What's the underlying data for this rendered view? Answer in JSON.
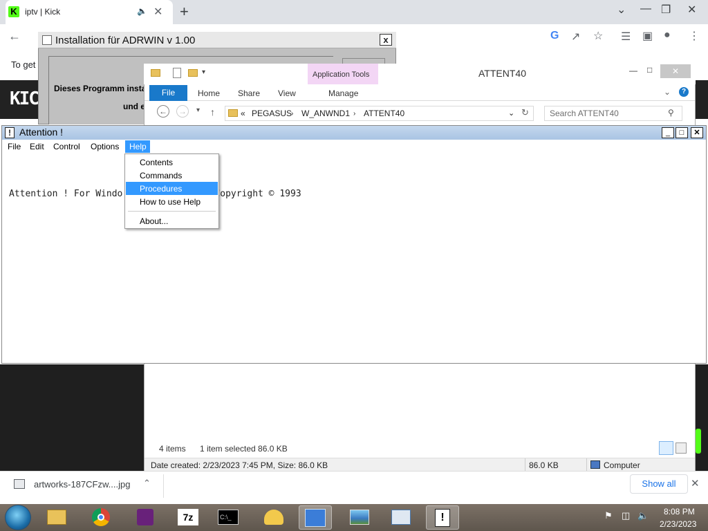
{
  "chrome": {
    "tab_title": "iptv | Kick",
    "tab_favicon": "K",
    "new_tab": "+",
    "webpage_text": "To get",
    "webpage_logo": "KIC"
  },
  "installer": {
    "title": "Installation für ADRWIN v 1.00",
    "close": "x",
    "line1": "Dieses Programm instal",
    "line2": "und e"
  },
  "explorer": {
    "app_tools": "Application Tools",
    "title": "ATTENT40",
    "ribbon_tabs": {
      "file": "File",
      "home": "Home",
      "share": "Share",
      "view": "View",
      "manage": "Manage"
    },
    "breadcrumb": {
      "sep": "«",
      "p1": "PEGASUS",
      "p2": "W_ANWND1",
      "p3": "ATTENT40"
    },
    "search_placeholder": "Search ATTENT40",
    "status_items": "4 items",
    "status_selected": "1 item selected  86.0 KB",
    "details_left": "Date created: 2/23/2023 7:45 PM, Size: 86.0 KB",
    "details_size": "86.0 KB",
    "details_location": "Computer"
  },
  "attention": {
    "title": "Attention !",
    "menubar": {
      "file": "File",
      "edit": "Edit",
      "control": "Control",
      "options": "Options",
      "help": "Help"
    },
    "body_text": "Attention ! For Windo              er Copyright © 1993",
    "help_menu": {
      "contents": "Contents",
      "commands": "Commands",
      "procedures": "Procedures",
      "how_to": "How to use Help",
      "about": "About..."
    }
  },
  "downloads": {
    "filename": "artworks-187CFzw....jpg",
    "show_all": "Show all"
  },
  "taskbar": {
    "time": "8:08 PM",
    "date": "2/23/2023"
  }
}
